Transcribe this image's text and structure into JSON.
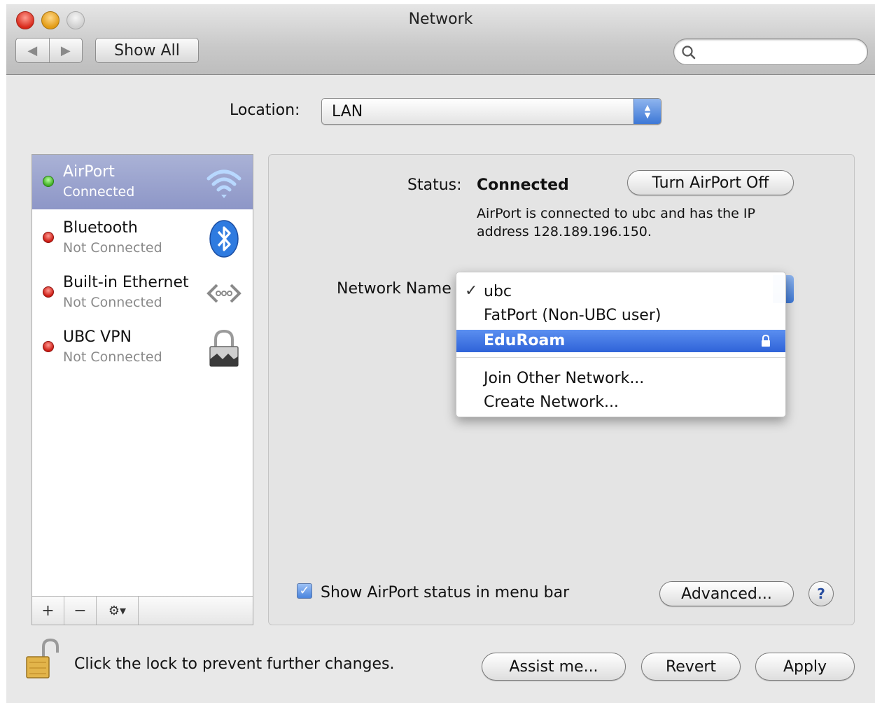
{
  "window": {
    "title": "Network"
  },
  "toolbar": {
    "back": "◀",
    "forward": "▶",
    "show_all": "Show All",
    "search_placeholder": ""
  },
  "location": {
    "label": "Location:",
    "value": "LAN"
  },
  "services": [
    {
      "name": "AirPort",
      "status": "Connected",
      "indicator": "green",
      "icon": "wifi-icon",
      "selected": true
    },
    {
      "name": "Bluetooth",
      "status": "Not Connected",
      "indicator": "red",
      "icon": "bluetooth-icon",
      "selected": false
    },
    {
      "name": "Built-in Ethernet",
      "status": "Not Connected",
      "indicator": "red",
      "icon": "ethernet-icon",
      "selected": false
    },
    {
      "name": "UBC VPN",
      "status": "Not Connected",
      "indicator": "red",
      "icon": "vpn-lock-icon",
      "selected": false
    }
  ],
  "sidebar_footer": {
    "add": "+",
    "remove": "−",
    "action": "⚙▾"
  },
  "panel": {
    "status_label": "Status:",
    "status_value": "Connected",
    "turn_off_button": "Turn AirPort Off",
    "status_description": "AirPort is connected to ubc and has the IP address 128.189.196.150.",
    "network_name_label": "Network Name",
    "network_menu": {
      "items": [
        {
          "label": "ubc",
          "checked": true,
          "highlighted": false,
          "locked": false
        },
        {
          "label": "FatPort (Non-UBC user)",
          "checked": false,
          "highlighted": false,
          "locked": false
        },
        {
          "label": "EduRoam",
          "checked": false,
          "highlighted": true,
          "locked": true
        }
      ],
      "actions": [
        "Join Other Network...",
        "Create Network..."
      ]
    },
    "show_status_checkbox": {
      "label": "Show AirPort status in menu bar",
      "checked": true
    },
    "advanced_button": "Advanced...",
    "help_button": "?"
  },
  "footer": {
    "lock_text": "Click the lock to prevent further changes.",
    "assist_button": "Assist me...",
    "revert_button": "Revert",
    "apply_button": "Apply"
  },
  "colors": {
    "selection": "#8d96c7",
    "menu_highlight": "#2f63d8",
    "status_green": "#3fae22",
    "status_red": "#cc1a12"
  }
}
